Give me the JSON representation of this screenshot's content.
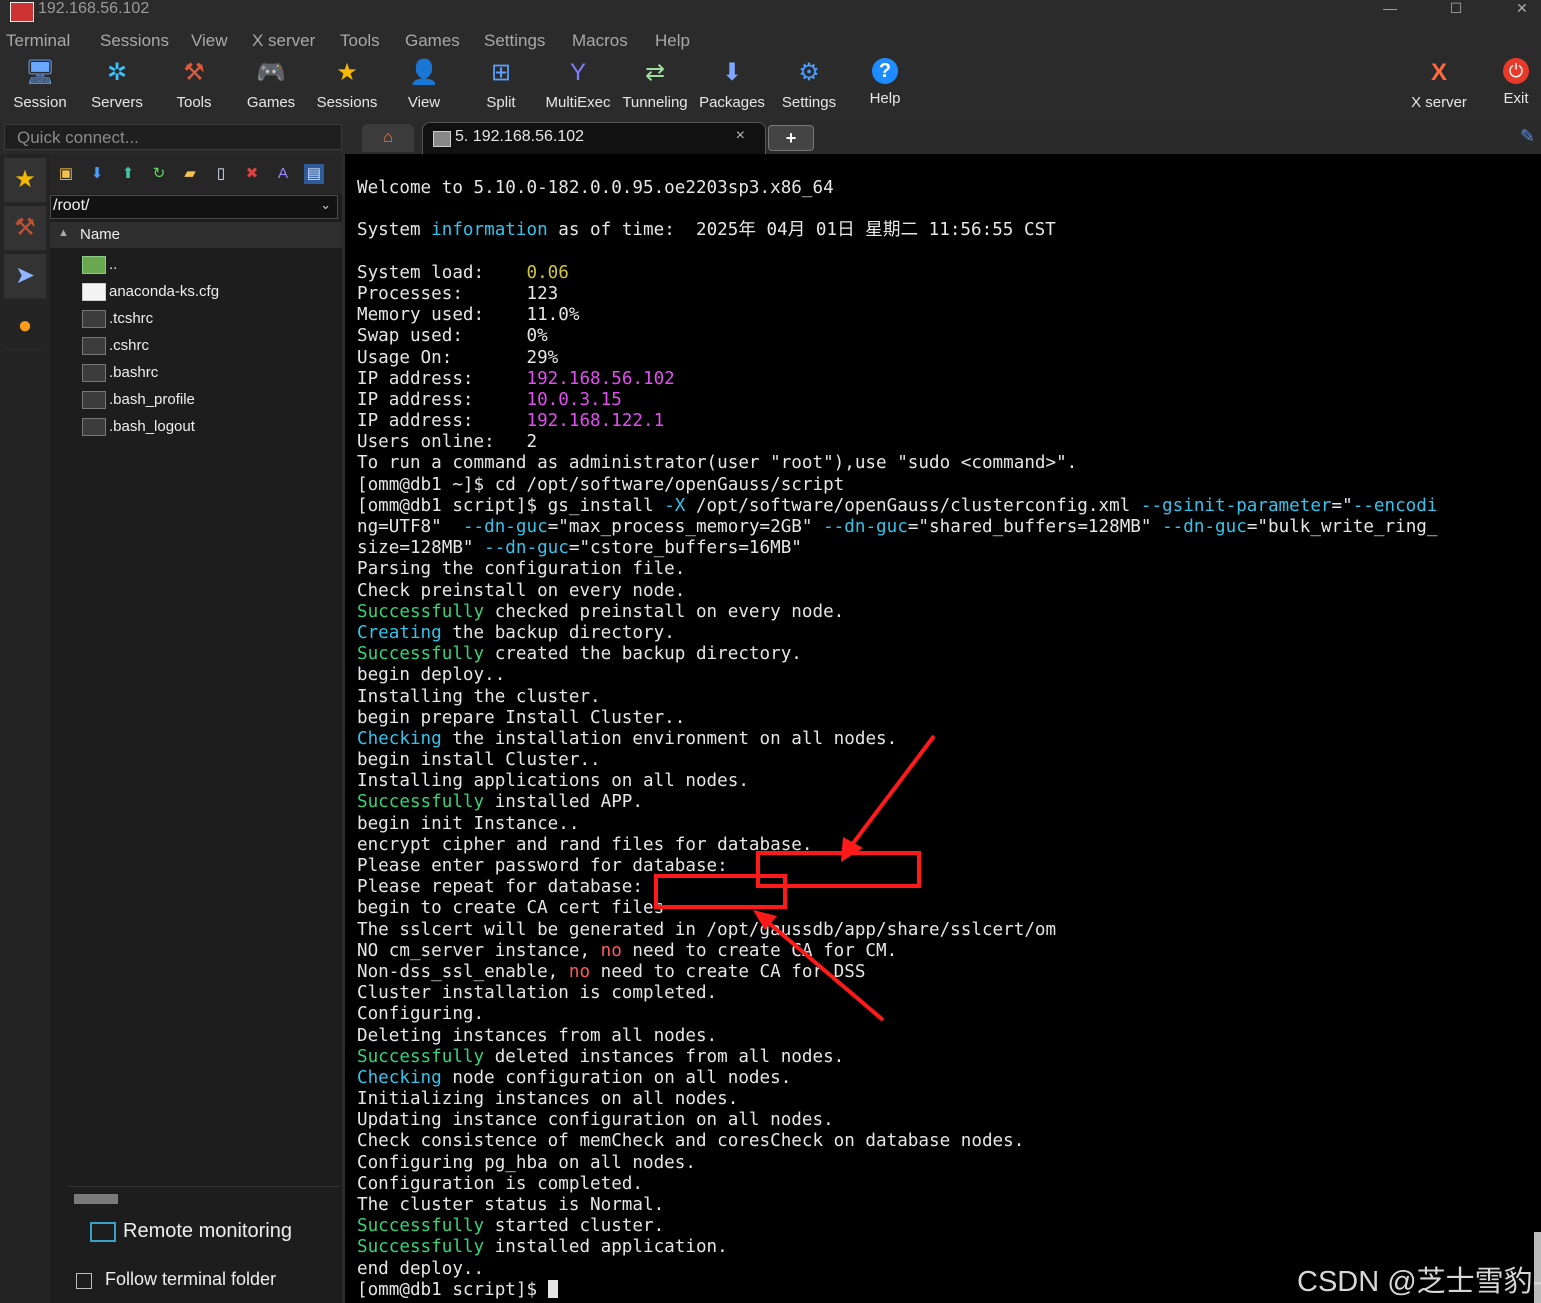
{
  "window": {
    "title": "192.168.56.102",
    "controls": [
      "—",
      "☐",
      "✕"
    ]
  },
  "menu": [
    "Terminal",
    "Sessions",
    "View",
    "X server",
    "Tools",
    "Games",
    "Settings",
    "Macros",
    "Help"
  ],
  "toolbar": {
    "session": "Session",
    "servers": "Servers",
    "tools": "Tools",
    "games": "Games",
    "sessions": "Sessions",
    "view": "View",
    "split": "Split",
    "multiexec": "MultiExec",
    "tunneling": "Tunneling",
    "packages": "Packages",
    "settings": "Settings",
    "help": "Help",
    "xserver": "X server",
    "exit": "Exit"
  },
  "quick_connect": {
    "placeholder": "Quick connect..."
  },
  "tabs": {
    "session_label": "5. 192.168.56.102",
    "close": "×",
    "new": "+"
  },
  "sidebar": {
    "path": "/root/",
    "column": "Name",
    "files": [
      "..",
      "anaconda-ks.cfg",
      ".tcshrc",
      ".cshrc",
      ".bashrc",
      ".bash_profile",
      ".bash_logout"
    ],
    "remote_monitoring": "Remote monitoring",
    "follow_terminal_folder": "Follow terminal folder"
  },
  "terminal": {
    "colors": {
      "cyan": "#33c4ec",
      "green": "#35d37a",
      "yellow": "#d2c736",
      "magenta": "#e34df0",
      "red": "#ff5a5a"
    },
    "lines": [
      [
        {
          "t": "Welcome to 5.10.0-182.0.0.95.oe2203sp3.x86_64"
        }
      ],
      [
        {
          "t": ""
        }
      ],
      [
        {
          "t": "System "
        },
        {
          "t": "information",
          "c": "cyan"
        },
        {
          "t": " as of time:  2025年 04月 01日 星期二 11:56:55 CST"
        }
      ],
      [
        {
          "t": ""
        }
      ],
      [
        {
          "t": "System load:    "
        },
        {
          "t": "0.06",
          "c": "yellow"
        }
      ],
      [
        {
          "t": "Processes:      123"
        }
      ],
      [
        {
          "t": "Memory used:    11.0%"
        }
      ],
      [
        {
          "t": "Swap used:      0%"
        }
      ],
      [
        {
          "t": "Usage On:       29%"
        }
      ],
      [
        {
          "t": "IP address:     "
        },
        {
          "t": "192.168.56.102",
          "c": "magenta"
        }
      ],
      [
        {
          "t": "IP address:     "
        },
        {
          "t": "10.0.3.15",
          "c": "magenta"
        }
      ],
      [
        {
          "t": "IP address:     "
        },
        {
          "t": "192.168.122.1",
          "c": "magenta"
        }
      ],
      [
        {
          "t": "Users online:   2"
        }
      ],
      [
        {
          "t": "To run a command as administrator(user \"root\"),use \"sudo <command>\"."
        }
      ],
      [
        {
          "t": "[omm@db1 ~]$ cd /opt/software/openGauss/script"
        }
      ],
      [
        {
          "t": "[omm@db1 script]$ gs_install "
        },
        {
          "t": "-X",
          "c": "cyan"
        },
        {
          "t": " /opt/software/openGauss/clusterconfig.xml "
        },
        {
          "t": "--gsinit-parameter",
          "c": "cyan"
        },
        {
          "t": "=\""
        },
        {
          "t": "--encodi",
          "c": "cyan"
        }
      ],
      [
        {
          "t": "ng=UTF8\"  "
        },
        {
          "t": "--dn-guc",
          "c": "cyan"
        },
        {
          "t": "=\"max_process_memory=2GB\" "
        },
        {
          "t": "--dn-guc",
          "c": "cyan"
        },
        {
          "t": "=\"shared_buffers=128MB\" "
        },
        {
          "t": "--dn-guc",
          "c": "cyan"
        },
        {
          "t": "=\"bulk_write_ring_"
        }
      ],
      [
        {
          "t": "size=128MB\" "
        },
        {
          "t": "--dn-guc",
          "c": "cyan"
        },
        {
          "t": "=\"cstore_buffers=16MB\""
        }
      ],
      [
        {
          "t": "Parsing the configuration file."
        }
      ],
      [
        {
          "t": "Check preinstall on every node."
        }
      ],
      [
        {
          "t": "Successfully",
          "c": "green"
        },
        {
          "t": " checked preinstall on every node."
        }
      ],
      [
        {
          "t": "Creating",
          "c": "cyan"
        },
        {
          "t": " the backup directory."
        }
      ],
      [
        {
          "t": "Successfully",
          "c": "green"
        },
        {
          "t": " created the backup directory."
        }
      ],
      [
        {
          "t": "begin deploy.."
        }
      ],
      [
        {
          "t": "Installing the cluster."
        }
      ],
      [
        {
          "t": "begin prepare Install Cluster.."
        }
      ],
      [
        {
          "t": "Checking",
          "c": "cyan"
        },
        {
          "t": " the installation environment on all nodes."
        }
      ],
      [
        {
          "t": "begin install Cluster.."
        }
      ],
      [
        {
          "t": "Installing applications on all nodes."
        }
      ],
      [
        {
          "t": "Successfully",
          "c": "green"
        },
        {
          "t": " installed APP."
        }
      ],
      [
        {
          "t": "begin init Instance.."
        }
      ],
      [
        {
          "t": "encrypt cipher and rand files for database."
        }
      ],
      [
        {
          "t": "Please enter password for database:"
        }
      ],
      [
        {
          "t": "Please repeat for database:"
        }
      ],
      [
        {
          "t": "begin to create CA cert files"
        }
      ],
      [
        {
          "t": "The sslcert will be generated in /opt/gaussdb/app/share/sslcert/om"
        }
      ],
      [
        {
          "t": "NO cm_server instance, "
        },
        {
          "t": "no",
          "c": "red"
        },
        {
          "t": " need to create CA for CM."
        }
      ],
      [
        {
          "t": "Non-dss_ssl_enable, "
        },
        {
          "t": "no",
          "c": "red"
        },
        {
          "t": " need to create CA for DSS"
        }
      ],
      [
        {
          "t": "Cluster installation is completed."
        }
      ],
      [
        {
          "t": "Configuring."
        }
      ],
      [
        {
          "t": "Deleting instances from all nodes."
        }
      ],
      [
        {
          "t": "Successfully",
          "c": "green"
        },
        {
          "t": " deleted instances from all nodes."
        }
      ],
      [
        {
          "t": "Checking",
          "c": "cyan"
        },
        {
          "t": " node configuration on all nodes."
        }
      ],
      [
        {
          "t": "Initializing instances on all nodes."
        }
      ],
      [
        {
          "t": "Updating instance configuration on all nodes."
        }
      ],
      [
        {
          "t": "Check consistence of memCheck and coresCheck on database nodes."
        }
      ],
      [
        {
          "t": "Configuring pg_hba on all nodes."
        }
      ],
      [
        {
          "t": "Configuration is completed."
        }
      ],
      [
        {
          "t": "The cluster status is Normal."
        }
      ],
      [
        {
          "t": "Successfully",
          "c": "green"
        },
        {
          "t": " started cluster."
        }
      ],
      [
        {
          "t": "Successfully",
          "c": "green"
        },
        {
          "t": " installed application."
        }
      ],
      [
        {
          "t": "end deploy.."
        }
      ],
      [
        {
          "t": "[omm@db1 script]$ "
        },
        {
          "cursor": true
        }
      ]
    ]
  },
  "watermark": "CSDN @芝士雪豹-"
}
